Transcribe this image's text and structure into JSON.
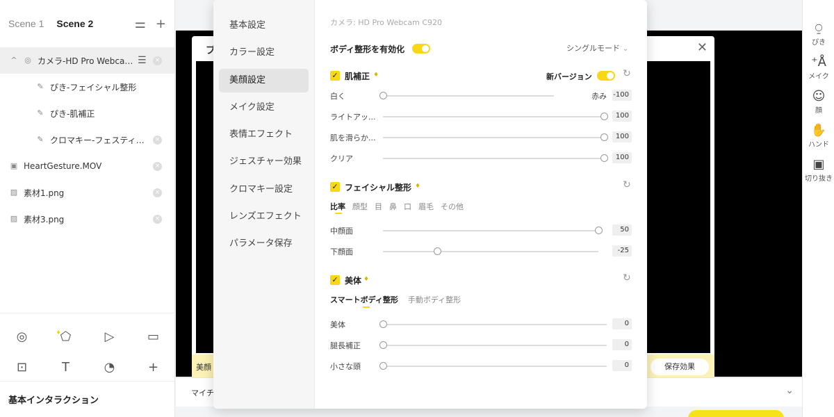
{
  "left": {
    "scenes": [
      "Scene 1",
      "Scene 2"
    ],
    "sources": [
      {
        "label": "カメラ-HD Pro Webcam ...",
        "icon": "camera-icon"
      },
      {
        "label": "ぴき-フェイシャル整形",
        "icon": "effect-icon"
      },
      {
        "label": "ぴき-肌補正",
        "icon": "effect-icon"
      },
      {
        "label": "クロマキー-フェスティバ...",
        "icon": "effect-icon"
      },
      {
        "label": "HeartGesture.MOV",
        "icon": "video-icon"
      },
      {
        "label": "素材1.png",
        "icon": "image-icon"
      },
      {
        "label": "素材3.png",
        "icon": "image-icon"
      }
    ],
    "basic_title": "基本インタラクション"
  },
  "right_tools": [
    {
      "label": "ぴき",
      "icon": "pikki-icon"
    },
    {
      "label": "メイク",
      "icon": "makeup-icon"
    },
    {
      "label": "顔",
      "icon": "face-icon"
    },
    {
      "label": "ハンド",
      "icon": "hand-icon"
    },
    {
      "label": "切り抜き",
      "icon": "cutout-icon"
    }
  ],
  "preview": {
    "dialog_title": "プ",
    "footer_label": "美顔",
    "save_label": "保存効果",
    "bottom_label": "マイチ"
  },
  "menu": [
    "基本設定",
    "カラー設定",
    "美顔設定",
    "メイク設定",
    "表情エフェクト",
    "ジェスチャー効果",
    "クロマキー設定",
    "レンズエフェクト",
    "パラメータ保存"
  ],
  "content": {
    "camera": "カメラ: HD Pro Webcam C920",
    "body_toggle": "ボディ整形を有効化",
    "mode": "シングルモード",
    "skin": {
      "title": "肌補正",
      "version": "新バージョン",
      "rows": [
        {
          "label": "白く",
          "right_label": "赤み",
          "value": "-100",
          "level": 0
        },
        {
          "label": "ライトアッ...",
          "value": "100",
          "level": 1
        },
        {
          "label": "肌を滑らか...",
          "value": "100",
          "level": 1
        },
        {
          "label": "クリア",
          "value": "100",
          "level": 1
        }
      ]
    },
    "facial": {
      "title": "フェイシャル整形",
      "tabs": [
        "比率",
        "顔型",
        "目",
        "鼻",
        "口",
        "眉毛",
        "その他"
      ],
      "rows": [
        {
          "label": "中顔面",
          "value": "50",
          "level": 1
        },
        {
          "label": "下顔面",
          "value": "-25",
          "level": 0.25
        }
      ]
    },
    "body": {
      "title": "美体",
      "tabs": [
        "スマートボディ整形",
        "手動ボディ整形"
      ],
      "rows": [
        {
          "label": "美体",
          "value": "0",
          "level": 0
        },
        {
          "label": "腿長補正",
          "value": "0",
          "level": 0
        },
        {
          "label": "小さな頭",
          "value": "0",
          "level": 0
        }
      ]
    }
  }
}
